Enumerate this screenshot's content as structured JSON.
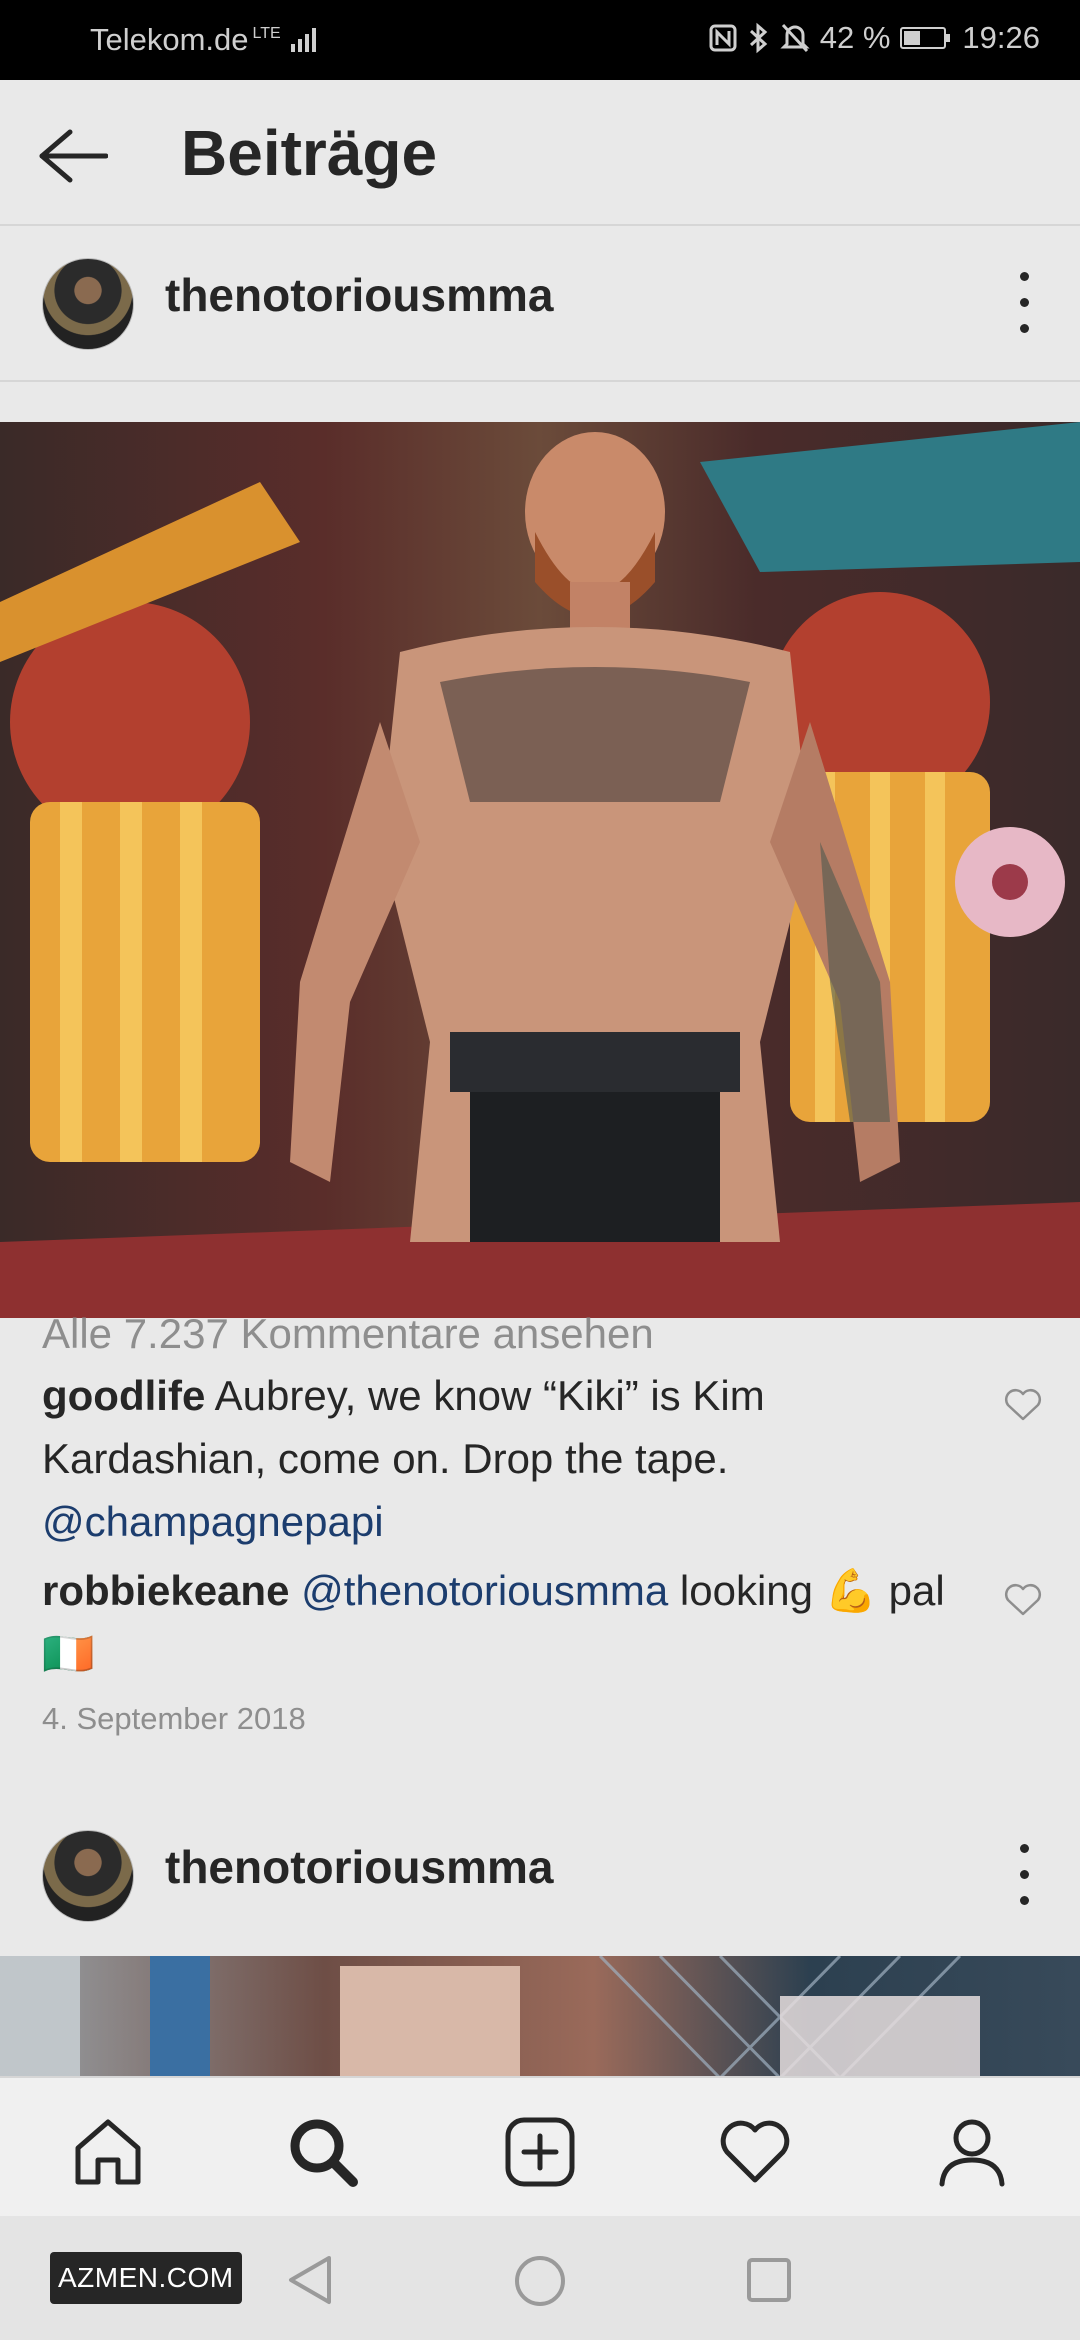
{
  "status_bar": {
    "carrier": "Telekom.de",
    "network": "LTE",
    "battery": "42 %",
    "battery_level": 0.42,
    "time": "19:26"
  },
  "header": {
    "title": "Beiträge"
  },
  "post": {
    "username": "thenotoriousmma",
    "view_all_comments": "Alle 7.237 Kommentare ansehen",
    "comments": [
      {
        "user": "goodlife",
        "text": " Aubrey, we know “Kiki” is Kim Kardashian, come on. Drop the tape. ",
        "mention": "@champagnepapi",
        "after": ""
      },
      {
        "user": "robbiekeane",
        "text": " ",
        "mention": "@thenotoriousmma",
        "after": " looking 💪 pal 🇮🇪"
      }
    ],
    "date": "4. September 2018"
  },
  "next_post": {
    "username": "thenotoriousmma"
  },
  "nav": {
    "items": [
      "home-icon",
      "search-icon",
      "add-post-icon",
      "heart-icon",
      "profile-icon"
    ],
    "active": "search-icon"
  },
  "watermark": "AZMEN.COM"
}
